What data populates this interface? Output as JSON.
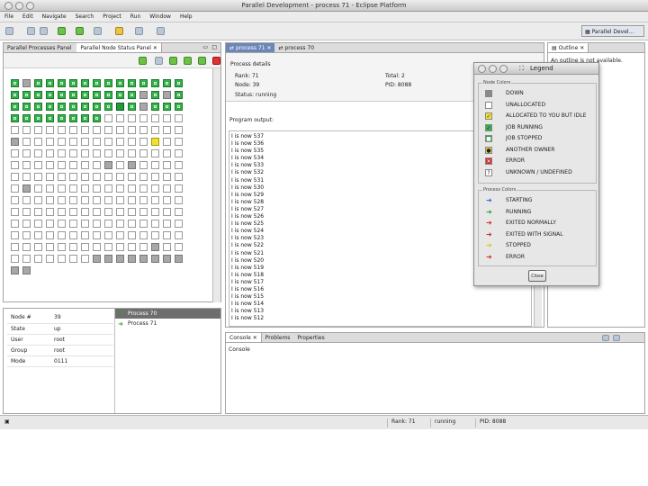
{
  "window": {
    "title": "Parallel Development - process 71 - Eclipse Platform"
  },
  "menu": [
    "File",
    "Edit",
    "Navigate",
    "Search",
    "Project",
    "Run",
    "Window",
    "Help"
  ],
  "perspective": "Parallel Devel...",
  "left_tabs": {
    "processes": "Parallel Processes Panel",
    "nodes": "Parallel Node Status Panel"
  },
  "node_grid": [
    "r",
    "u",
    "r",
    "r",
    "r",
    "r",
    "r",
    "r",
    "r",
    "r",
    "r",
    "r",
    "r",
    "r",
    "r",
    "r",
    "r",
    "r",
    "r",
    "r",
    "r",
    "r",
    "r",
    "r",
    "r",
    "r",
    "u",
    "r",
    "u",
    "r",
    "r",
    "r",
    "r",
    "r",
    "r",
    "r",
    "r",
    "r",
    "r",
    "s",
    "r",
    "u",
    "r",
    "r",
    "r",
    "r",
    "r",
    "r",
    "r",
    "r",
    "r",
    "r",
    "r",
    "w",
    "w",
    "w",
    "w",
    "w",
    "w",
    "w",
    "w",
    "w",
    "w",
    "w",
    "w",
    "w",
    "w",
    "w",
    "w",
    "w",
    "w",
    "w",
    "w",
    "w",
    "w",
    "u",
    "w",
    "w",
    "w",
    "w",
    "w",
    "w",
    "w",
    "w",
    "w",
    "w",
    "w",
    "y",
    "w",
    "w",
    "w",
    "w",
    "w",
    "w",
    "w",
    "w",
    "w",
    "w",
    "w",
    "w",
    "w",
    "w",
    "w",
    "w",
    "w",
    "w",
    "w",
    "w",
    "w",
    "w",
    "w",
    "w",
    "w",
    "u",
    "w",
    "u",
    "w",
    "w",
    "w",
    "w",
    "w",
    "w",
    "w",
    "w",
    "w",
    "w",
    "w",
    "w",
    "w",
    "w",
    "w",
    "w",
    "w",
    "w",
    "w",
    "w",
    "u",
    "w",
    "w",
    "w",
    "w",
    "w",
    "w",
    "w",
    "w",
    "w",
    "w",
    "w",
    "w",
    "w",
    "w",
    "w",
    "w",
    "w",
    "w",
    "w",
    "w",
    "w",
    "w",
    "w",
    "w",
    "w",
    "w",
    "w",
    "w",
    "w",
    "w",
    "w",
    "w",
    "w",
    "w",
    "w",
    "w",
    "w",
    "w",
    "w",
    "w",
    "w",
    "w",
    "w",
    "w",
    "w",
    "w",
    "w",
    "w",
    "w",
    "w",
    "w",
    "w",
    "w",
    "w",
    "w",
    "w",
    "w",
    "w",
    "w",
    "w",
    "w",
    "w",
    "w",
    "w",
    "w",
    "w",
    "w",
    "w",
    "w",
    "w",
    "w",
    "w",
    "w",
    "w",
    "w",
    "w",
    "w",
    "w",
    "w",
    "w",
    "w",
    "w",
    "w",
    "w",
    "w",
    "u",
    "w",
    "w",
    "w",
    "w",
    "w",
    "w",
    "w",
    "w",
    "w",
    "u",
    "u",
    "u",
    "u",
    "u",
    "u",
    "u",
    "u",
    "u",
    "u"
  ],
  "node_info": [
    {
      "k": "Node #",
      "v": "39"
    },
    {
      "k": "State",
      "v": "up"
    },
    {
      "k": "User",
      "v": "root"
    },
    {
      "k": "Group",
      "v": "root"
    },
    {
      "k": "Mode",
      "v": "0111"
    }
  ],
  "process_list": [
    "Process 70",
    "Process 71"
  ],
  "editor_tabs": [
    "process 71",
    "process 70"
  ],
  "process_details": {
    "heading": "Process details",
    "rank": "Rank: 71",
    "node": "Node: 39",
    "status": "Status: running",
    "total": "Total: 2",
    "pid": "PID: 8088",
    "output_label": "Program output:"
  },
  "output_lines": [
    "I is now 537",
    "I is now 536",
    "I is now 535",
    "I is now 534",
    "I is now 533",
    "I is now 532",
    "I is now 531",
    "I is now 530",
    "I is now 529",
    "I is now 528",
    "I is now 527",
    "I is now 526",
    "I is now 525",
    "I is now 524",
    "I is now 523",
    "I is now 522",
    "I is now 521",
    "I is now 520",
    "I is now 519",
    "I is now 518",
    "I is now 517",
    "I is now 516",
    "I is now 515",
    "I is now 514",
    "I is now 513",
    "I is now 512"
  ],
  "outline": {
    "tab": "Outline",
    "message": "An outline is not available."
  },
  "console": {
    "tabs": [
      "Console",
      "Problems",
      "Properties"
    ],
    "label": "Console"
  },
  "legend": {
    "title": "Legend",
    "node_group": "Node Colors",
    "node_items": [
      {
        "label": "DOWN",
        "sw": "#8a8a8a",
        "glyph": ""
      },
      {
        "label": "UNALLOCATED",
        "sw": "#ffffff",
        "glyph": ""
      },
      {
        "label": "ALLOCATED TO YOU BUT IDLE",
        "sw": "#f0e030",
        "glyph": "✓"
      },
      {
        "label": "JOB RUNNING",
        "sw": "#33b24a",
        "glyph": "✓"
      },
      {
        "label": "JOB STOPPED",
        "sw": "#209a3a",
        "glyph": "■"
      },
      {
        "label": "ANOTHER OWNER",
        "sw": "#d9d04a",
        "glyph": "●"
      },
      {
        "label": "ERROR",
        "sw": "#d42a2a",
        "glyph": "✕"
      },
      {
        "label": "UNKNOWN / UNDEFINED",
        "sw": "#ffffff",
        "glyph": "?"
      }
    ],
    "proc_group": "Process Colors",
    "proc_items": [
      {
        "label": "STARTING",
        "color": "#2a6fd0"
      },
      {
        "label": "RUNNING",
        "color": "#2f9e2f"
      },
      {
        "label": "EXITED NORMALLY",
        "color": "#c83030"
      },
      {
        "label": "EXITED WITH SIGNAL",
        "color": "#c83030"
      },
      {
        "label": "STOPPED",
        "color": "#e0c020"
      },
      {
        "label": "ERROR",
        "color": "#c83030"
      }
    ],
    "close": "Close"
  },
  "status_bar": {
    "rank": "Rank: 71",
    "state": "running",
    "pid": "PID: 8088"
  }
}
